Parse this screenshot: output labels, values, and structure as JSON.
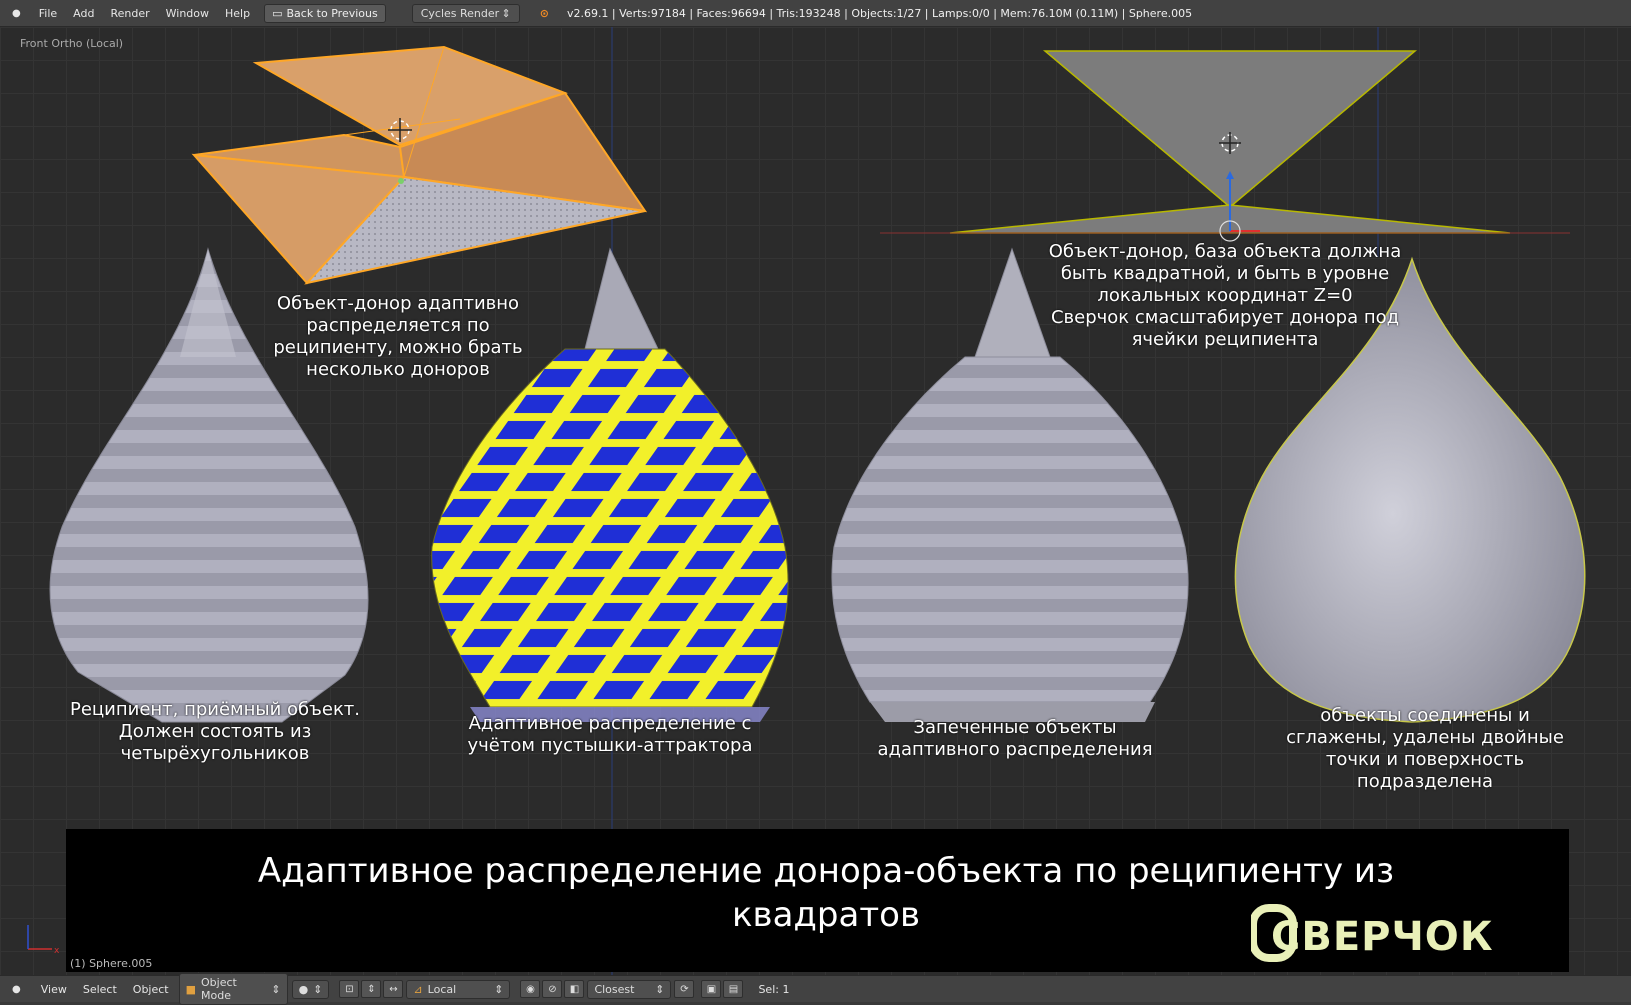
{
  "header": {
    "menu": [
      "File",
      "Add",
      "Render",
      "Window",
      "Help"
    ],
    "back_button": "Back to Previous",
    "render_engine": "Cycles Render",
    "stats": "v2.69.1 | Verts:97184 | Faces:96694 | Tris:193248 | Objects:1/27 | Lamps:0/0 | Mem:76.10M (0.11M) | Sphere.005"
  },
  "viewport": {
    "view_label": "Front Ortho (Local)",
    "object_label": "(1) Sphere.005",
    "captions": {
      "donor_adaptive": "Объект-донор адаптивно\nраспределяется по\nреципиенту, можно брать\nнесколько доноров",
      "donor_base": "Объект-донор, база объекта должна\nбыть квадратной, и быть в уровне\nлокальных координат Z=0\nСверчок смасштабирует донора под\nячейки реципиента",
      "recipient": "Реципиент, приёмный объект.\nДолжен состоять из\nчетырёхугольников",
      "attractor": "Адаптивное распределение с\nучётом пустышки-аттрактора",
      "baked": "Запеченные объекты\nадаптивного распределения",
      "joined": "объекты соединены и\nсглажены, удалены двойные\nточки и поверхность\nподразделена"
    },
    "banner_title": "Адаптивное распределение донора-объекта по реципиенту из\nквадратов",
    "logo_text": "СВЕРЧОК"
  },
  "footer": {
    "menu": [
      "View",
      "Select",
      "Object"
    ],
    "mode": "Object Mode",
    "pivot": "Local",
    "snap": "Closest",
    "selection": "Sel: 1"
  },
  "colors": {
    "donor_orange": "#d9a06a",
    "selection_outline": "#ffa726",
    "recipient_grey": "#b5b5c2",
    "pattern_blue": "#1f2fd6",
    "pattern_yellow": "#f2f02a"
  }
}
